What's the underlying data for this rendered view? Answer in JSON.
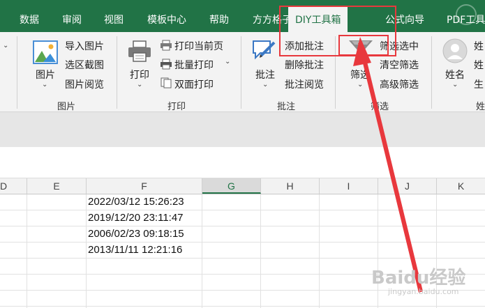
{
  "tabs": [
    {
      "label": "数据",
      "active": false
    },
    {
      "label": "审阅",
      "active": false
    },
    {
      "label": "视图",
      "active": false
    },
    {
      "label": "模板中心",
      "active": false
    },
    {
      "label": "帮助",
      "active": false
    },
    {
      "label": "方方格子",
      "active": false
    },
    {
      "label": "DIY工具箱",
      "active": true
    },
    {
      "label": "公式向导",
      "active": false
    },
    {
      "label": "PDF工具",
      "active": false
    }
  ],
  "ribbon": {
    "picture_group": {
      "big_label": "图片",
      "items": [
        "导入图片",
        "选区截图",
        "图片阅览"
      ],
      "group_label": "图片"
    },
    "print_group": {
      "big_label": "打印",
      "items": [
        "打印当前页",
        "批量打印",
        "双面打印"
      ],
      "group_label": "打印"
    },
    "comment_group": {
      "big_label": "批注",
      "items": [
        "添加批注",
        "删除批注",
        "批注阅览"
      ],
      "group_label": "批注"
    },
    "filter_group": {
      "big_label": "筛选",
      "items": [
        "筛选选中",
        "清空筛选",
        "高级筛选"
      ],
      "group_label": "筛选"
    },
    "name_group": {
      "big_label": "姓名",
      "items": [
        "姓",
        "姓",
        "生"
      ],
      "group_label": "姓"
    }
  },
  "columns": [
    "D",
    "E",
    "F",
    "G",
    "H",
    "I",
    "J",
    "K"
  ],
  "selected_column": "G",
  "cells_F": [
    "2022/03/12 15:26:23",
    "2019/12/20 23:11:47",
    "2006/02/23 09:18:15",
    "2013/11/11 12:21:16"
  ],
  "watermark": {
    "text": "Baidu经验",
    "sub": "jingyan.baidu.com"
  },
  "colors": {
    "accent": "#217346",
    "highlight": "#e8383d",
    "ribbon_bg": "#f3f3f3"
  }
}
